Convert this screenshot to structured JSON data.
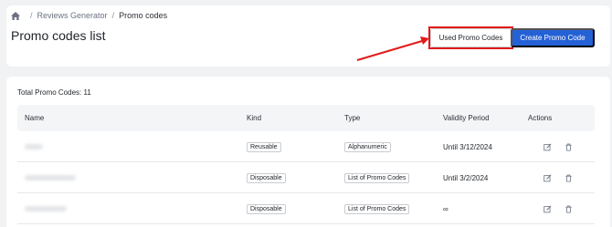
{
  "breadcrumb": {
    "home_icon": "home-icon",
    "sep": "/",
    "items": [
      "Reviews Generator",
      "Promo codes"
    ]
  },
  "header": {
    "title": "Promo codes list",
    "used_label": "Used Promo Codes",
    "create_label": "Create Promo Code"
  },
  "summary": {
    "total_label": "Total Promo Codes: 11"
  },
  "table": {
    "headers": [
      "Name",
      "Kind",
      "Type",
      "Validity Period",
      "Actions"
    ],
    "rows": [
      {
        "kind": "Reusable",
        "type": "Alphanumeric",
        "validity": "Until 3/12/2024"
      },
      {
        "kind": "Disposable",
        "type": "List of Promo Codes",
        "validity": "Until 3/2/2024"
      },
      {
        "kind": "Disposable",
        "type": "List of Promo Codes",
        "validity": "∞"
      }
    ]
  },
  "colors": {
    "primary": "#2561d6",
    "highlight": "#e21b1b"
  },
  "icons": {
    "edit": "edit-icon",
    "delete": "trash-icon"
  }
}
